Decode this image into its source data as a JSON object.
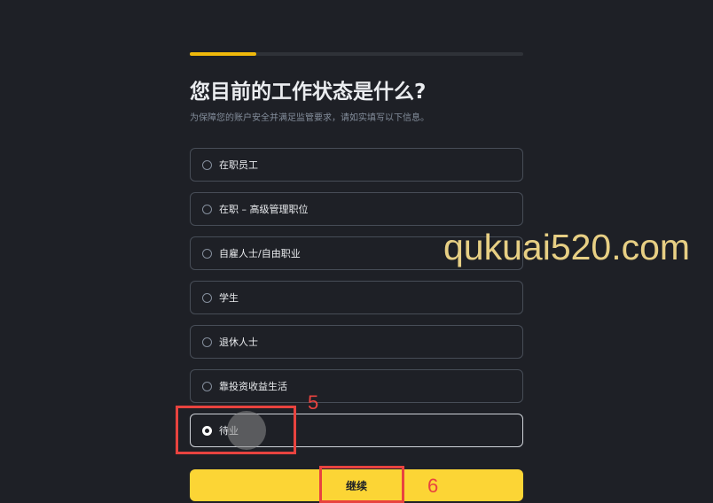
{
  "progress": {
    "fraction": 0.2
  },
  "page": {
    "title": "您目前的工作状态是什么?",
    "subtitle": "为保障您的账户安全并满足监管要求，请如实填写以下信息。"
  },
  "options": [
    {
      "label": "在职员工",
      "selected": false
    },
    {
      "label": "在职 – 高级管理职位",
      "selected": false
    },
    {
      "label": "自雇人士/自由职业",
      "selected": false
    },
    {
      "label": "学生",
      "selected": false
    },
    {
      "label": "退休人士",
      "selected": false
    },
    {
      "label": "靠投资收益生活",
      "selected": false
    },
    {
      "label": "待业",
      "selected": true
    }
  ],
  "continue_label": "继续",
  "annotations": {
    "step5": "5",
    "step6": "6"
  },
  "watermark": "qukuai520.com",
  "colors": {
    "background": "#1e2026",
    "accent": "#fcd535",
    "progress": "#f0b90b",
    "annotation": "#e8433f",
    "watermark": "#e7cf84"
  }
}
